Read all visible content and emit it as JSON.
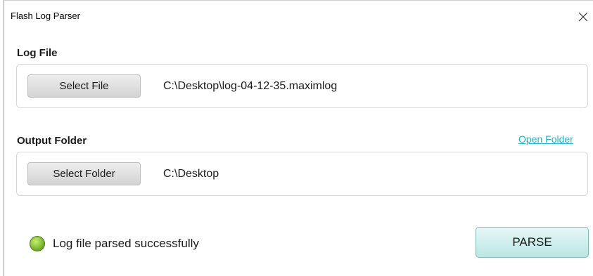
{
  "window": {
    "title": "Flash Log Parser",
    "close_icon": "close-icon"
  },
  "log_file": {
    "label": "Log File",
    "button_label": "Select File",
    "path": "C:\\Desktop\\log-04-12-35.maximlog"
  },
  "output_folder": {
    "label": "Output Folder",
    "open_link": "Open Folder",
    "button_label": "Select Folder",
    "path": "C:\\Desktop"
  },
  "status": {
    "icon": "status-led-icon",
    "text": "Log file parsed successfully",
    "color": "#8dc63f"
  },
  "actions": {
    "parse_label": "PARSE"
  },
  "colors": {
    "link": "#25b5c9",
    "parse_button": "#b9e6e3"
  }
}
